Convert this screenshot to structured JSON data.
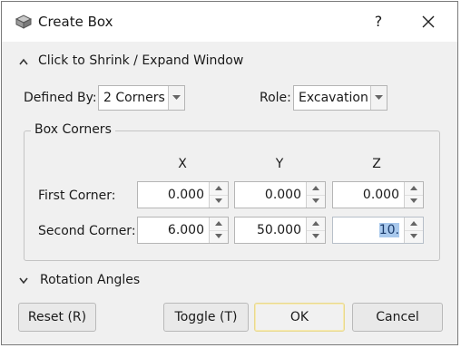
{
  "window": {
    "title": "Create Box",
    "help_label": "?"
  },
  "shrink": {
    "label": "Click to Shrink / Expand Window"
  },
  "defined_by": {
    "label": "Defined By:",
    "value": "2 Corners"
  },
  "role": {
    "label": "Role:",
    "value": "Excavation"
  },
  "box_corners": {
    "title": "Box Corners",
    "columns": [
      "X",
      "Y",
      "Z"
    ],
    "rows": [
      {
        "label": "First Corner:",
        "values": [
          "0.000",
          "0.000",
          "0.000"
        ]
      },
      {
        "label": "Second Corner:",
        "values": [
          "6.000",
          "50.000",
          "10."
        ]
      }
    ]
  },
  "rotation": {
    "label": "Rotation Angles"
  },
  "buttons": {
    "reset": "Reset (R)",
    "toggle": "Toggle (T)",
    "ok": "OK",
    "cancel": "Cancel"
  }
}
